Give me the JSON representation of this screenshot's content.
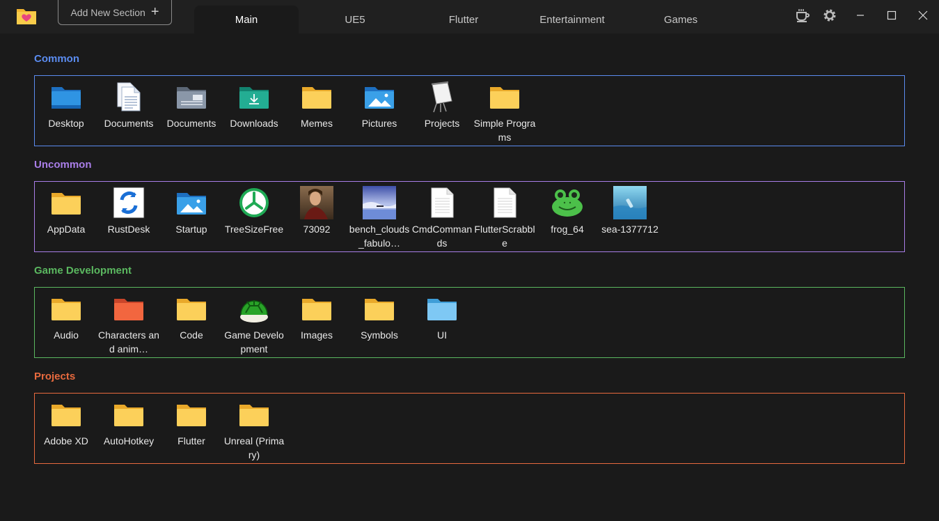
{
  "toolbar": {
    "add_section_label": "Add New Section",
    "add_section_icon": "+"
  },
  "tabs": [
    {
      "label": "Main",
      "active": true
    },
    {
      "label": "UE5",
      "active": false
    },
    {
      "label": "Flutter",
      "active": false
    },
    {
      "label": "Entertainment",
      "active": false
    },
    {
      "label": "Games",
      "active": false
    }
  ],
  "window_controls": [
    "coffee-icon",
    "gear-icon",
    "minimize-icon",
    "maximize-icon",
    "close-icon"
  ],
  "colors": {
    "common": "#5b8cf0",
    "uncommon": "#a97ee8",
    "game_development": "#5bb860",
    "projects": "#e86a3e"
  },
  "sections": [
    {
      "title": "Common",
      "items": [
        {
          "label": "Desktop",
          "icon": "desktop-folder-icon"
        },
        {
          "label": "Documents",
          "icon": "document-pages-icon"
        },
        {
          "label": "Documents",
          "icon": "documents-folder-icon"
        },
        {
          "label": "Downloads",
          "icon": "downloads-folder-icon"
        },
        {
          "label": "Memes",
          "icon": "folder-icon"
        },
        {
          "label": "Pictures",
          "icon": "pictures-folder-icon"
        },
        {
          "label": "Projects",
          "icon": "presentation-board-icon"
        },
        {
          "label": "Simple Programs",
          "icon": "folder-icon"
        }
      ]
    },
    {
      "title": "Uncommon",
      "items": [
        {
          "label": "AppData",
          "icon": "folder-icon"
        },
        {
          "label": "RustDesk",
          "icon": "rustdesk-icon"
        },
        {
          "label": "Startup",
          "icon": "pictures-folder-icon"
        },
        {
          "label": "TreeSizeFree",
          "icon": "treesize-icon"
        },
        {
          "label": "73092",
          "icon": "portrait-image-icon"
        },
        {
          "label": "bench_clouds_fabulo…",
          "icon": "landscape-image-icon"
        },
        {
          "label": "CmdCommands",
          "icon": "text-file-icon"
        },
        {
          "label": "FlutterScrabble",
          "icon": "text-file-icon"
        },
        {
          "label": "frog_64",
          "icon": "frog-icon"
        },
        {
          "label": "sea-1377712",
          "icon": "sea-image-icon"
        }
      ]
    },
    {
      "title": "Game Development",
      "items": [
        {
          "label": "Audio",
          "icon": "folder-icon"
        },
        {
          "label": "Characters and anim…",
          "icon": "red-folder-icon"
        },
        {
          "label": "Code",
          "icon": "folder-icon"
        },
        {
          "label": "Game Development",
          "icon": "turtle-shell-icon"
        },
        {
          "label": "Images",
          "icon": "folder-icon"
        },
        {
          "label": "Symbols",
          "icon": "folder-icon"
        },
        {
          "label": "UI",
          "icon": "blue-folder-icon"
        }
      ]
    },
    {
      "title": "Projects",
      "items": [
        {
          "label": "Adobe XD",
          "icon": "folder-icon"
        },
        {
          "label": "AutoHotkey",
          "icon": "folder-icon"
        },
        {
          "label": "Flutter",
          "icon": "folder-icon"
        },
        {
          "label": "Unreal (Primary)",
          "icon": "folder-icon"
        }
      ]
    }
  ]
}
